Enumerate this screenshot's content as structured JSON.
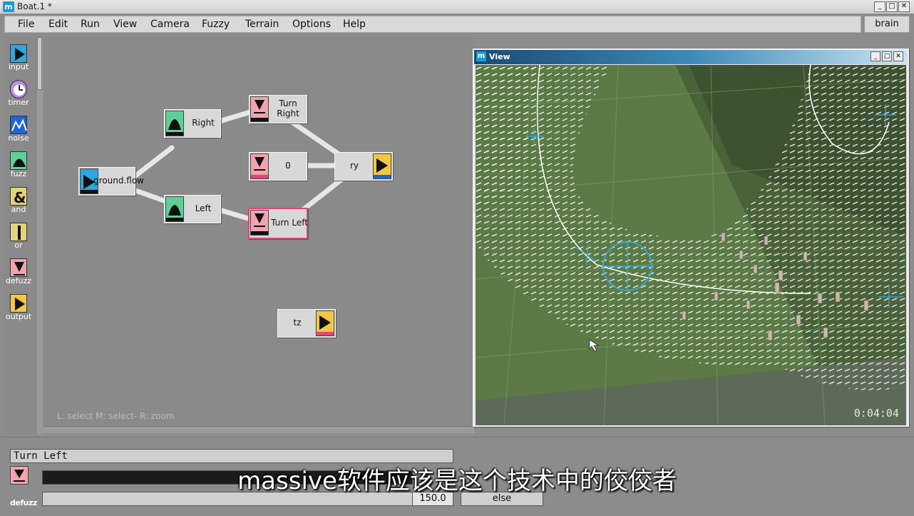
{
  "window": {
    "title": "Boat.1 *",
    "app_icon": "m",
    "minimize": "_",
    "maximize": "□",
    "close": "✕"
  },
  "menu": {
    "items": [
      "File",
      "Edit",
      "Run",
      "View",
      "Camera",
      "Fuzzy",
      "Terrain",
      "Options",
      "Help"
    ],
    "brain_button": "brain"
  },
  "palette": [
    {
      "label": "input",
      "icon": "input-icon",
      "color": "#2aa8e0"
    },
    {
      "label": "timer",
      "icon": "timer-icon",
      "color": "#b98ce8"
    },
    {
      "label": "noise",
      "icon": "noise-icon",
      "color": "#1e66d6"
    },
    {
      "label": "fuzz",
      "icon": "fuzz-icon",
      "color": "#5fcf96"
    },
    {
      "label": "and",
      "icon": "and-icon",
      "color": "#e3d27a"
    },
    {
      "label": "or",
      "icon": "or-icon",
      "color": "#e3d27a"
    },
    {
      "label": "defuzz",
      "icon": "defuzz-icon",
      "color": "#f4a2ad"
    },
    {
      "label": "output",
      "icon": "output-icon",
      "color": "#f2c743"
    }
  ],
  "graph": {
    "nodes": {
      "ground_flow": "ground.flow",
      "right": "Right",
      "left": "Left",
      "turn_right_1": "Turn",
      "turn_right_2": "Right",
      "zero": "0",
      "turn_left": "Turn Left",
      "ry": "ry",
      "tz": "tz"
    },
    "hint": "L: select   M: select-   R: zoom"
  },
  "view": {
    "title": "View",
    "timecode": "0:04:04"
  },
  "inspector": {
    "node_name": "Turn Left",
    "value": "150.0",
    "else_label": "else",
    "type_label": "defuzz"
  },
  "subtitle": "massive软件应该是这个技术中的佼佼者",
  "colors": {
    "accent_pink": "#e0457a",
    "defuzz_pink": "#f4a2ad",
    "fuzz_green": "#5fcf96",
    "input_blue": "#2aa8e0",
    "output_yellow": "#f2c743"
  }
}
